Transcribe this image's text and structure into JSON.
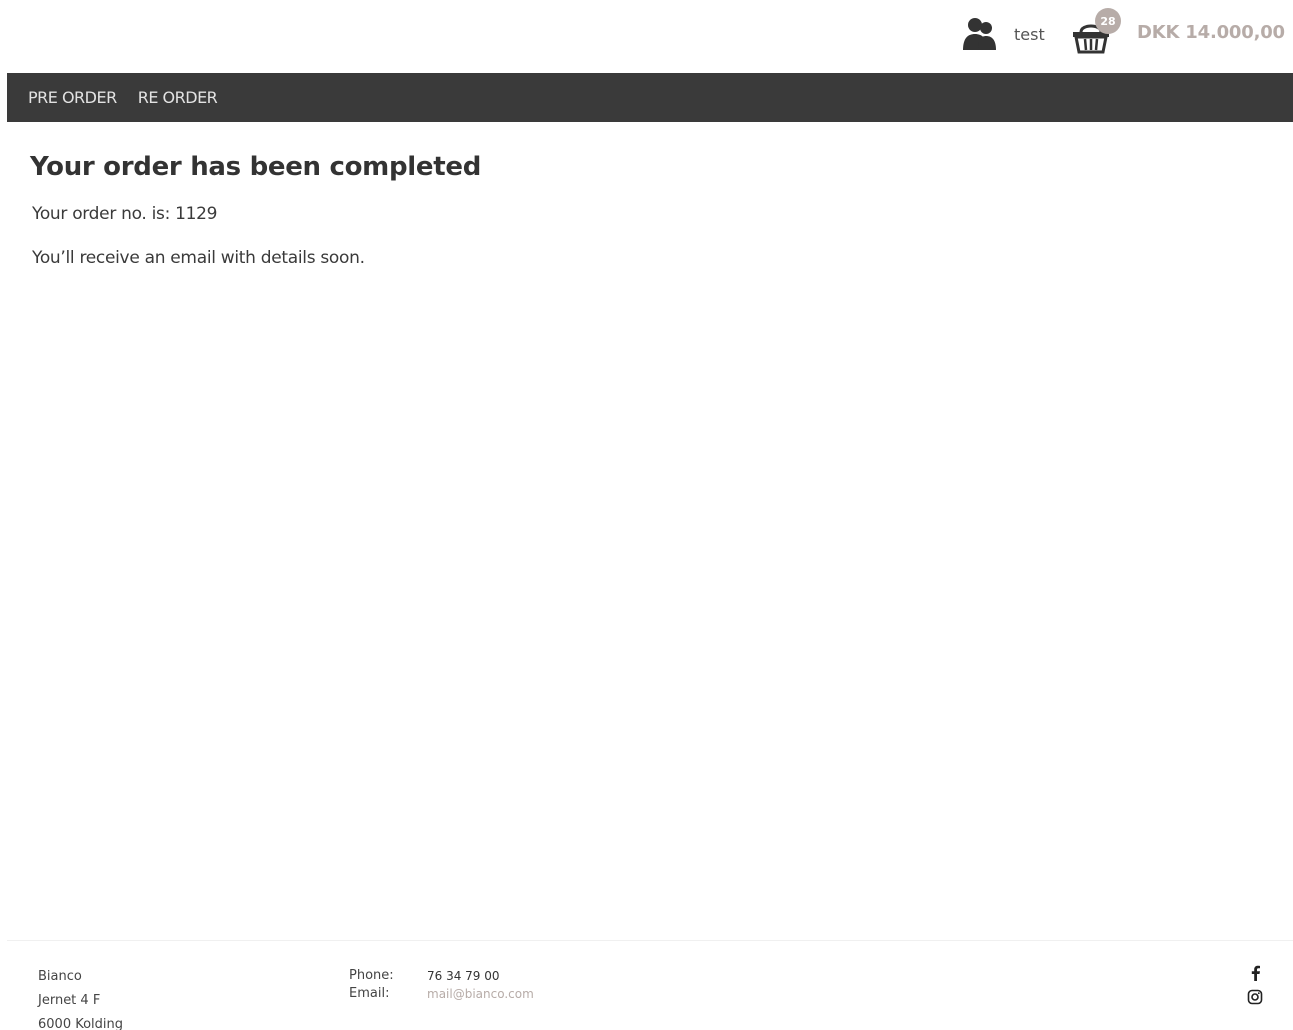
{
  "header": {
    "username": "test",
    "cart_count": "28",
    "cart_total": "DKK 14.000,00",
    "user_icon": "user-silhouette-icon",
    "cart_icon": "basket-icon"
  },
  "nav": {
    "items": [
      {
        "label": "PRE ORDER"
      },
      {
        "label": "RE ORDER"
      }
    ]
  },
  "main": {
    "title": "Your order has been completed",
    "order_number_text": "Your order no. is: 1129",
    "email_notice": "You’ll receive an email with details soon."
  },
  "footer": {
    "address": [
      "Bianco",
      "Jernet 4 F",
      "6000 Kolding"
    ],
    "phone_label": "Phone:",
    "phone_value": "76 34 79 00",
    "email_label": "Email:",
    "email_value": "mail@bianco.com",
    "social_icons": [
      "facebook-icon",
      "instagram-icon"
    ]
  },
  "colors": {
    "nav_background": "#3a3a3a",
    "accent": "#b7aca8",
    "text": "#333333"
  }
}
